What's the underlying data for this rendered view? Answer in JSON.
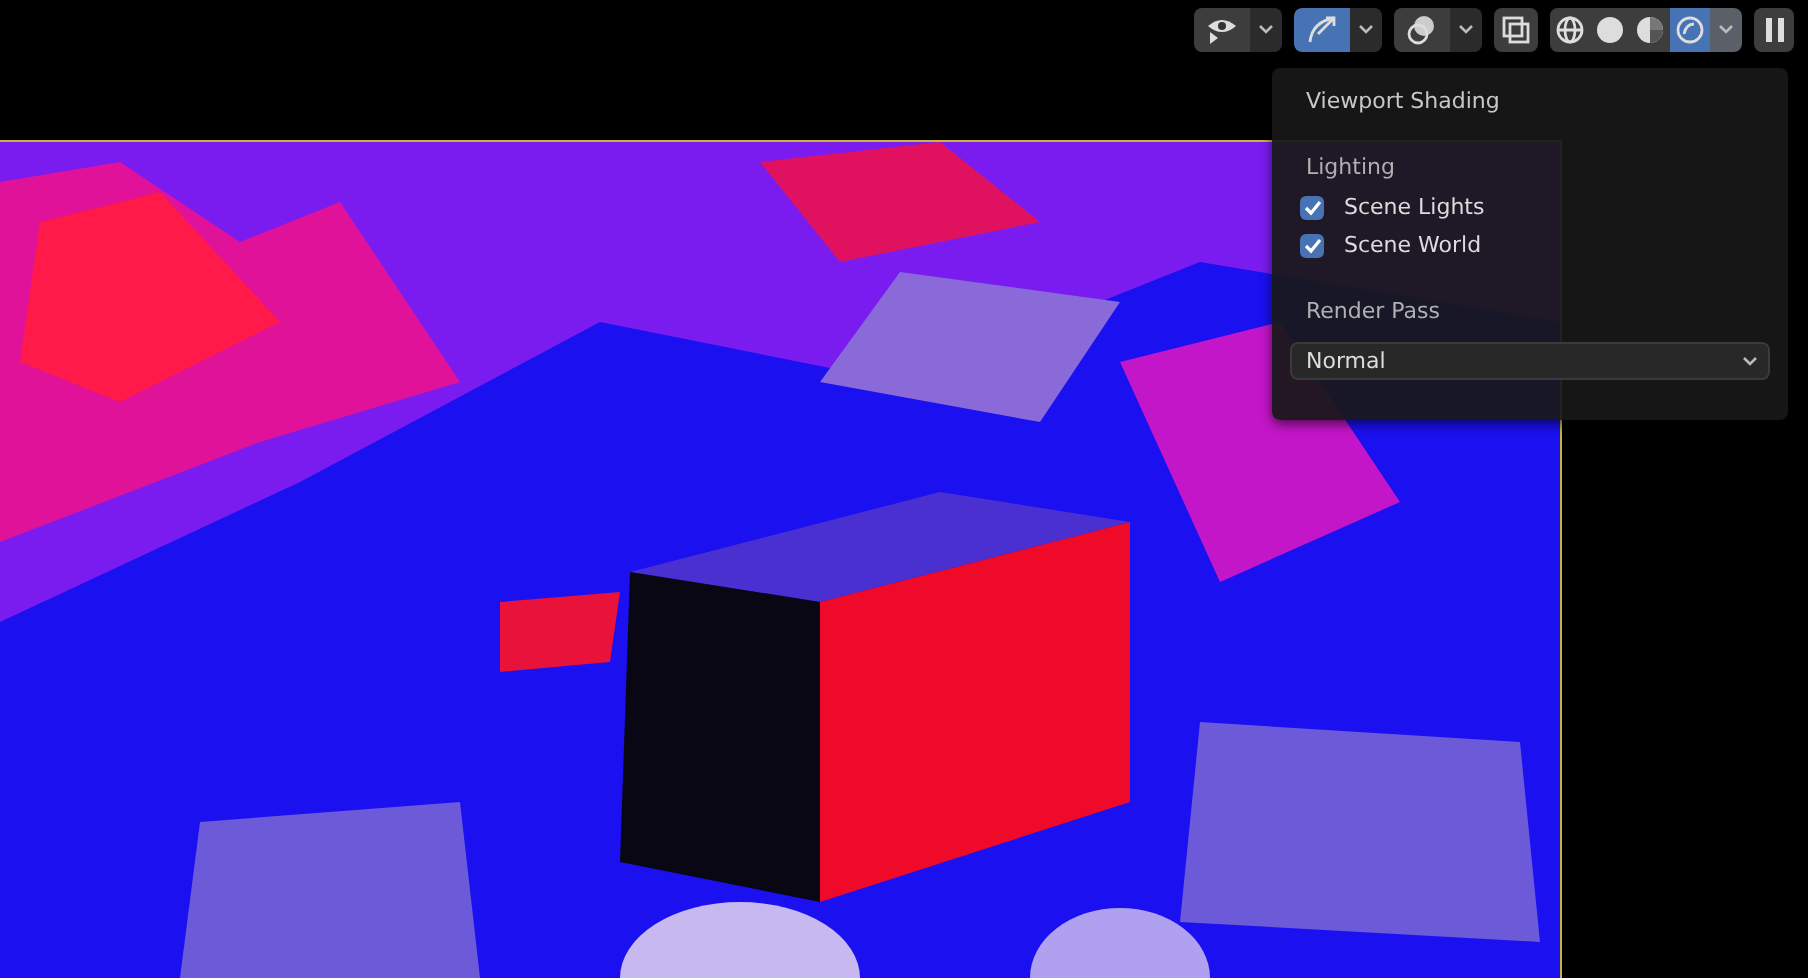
{
  "header": {
    "tools": [
      {
        "kind": "visibility",
        "selected": false
      },
      {
        "kind": "gizmo",
        "selected": true
      },
      {
        "kind": "overlay",
        "selected": false
      },
      {
        "kind": "xray",
        "selected": false
      }
    ],
    "shading_modes": [
      {
        "kind": "wireframe",
        "selected": false
      },
      {
        "kind": "solid",
        "selected": false
      },
      {
        "kind": "material",
        "selected": false
      },
      {
        "kind": "rendered",
        "selected": true
      }
    ]
  },
  "shading_popover": {
    "title": "Viewport Shading",
    "lighting": {
      "heading": "Lighting",
      "options": [
        {
          "label": "Scene Lights",
          "checked": true
        },
        {
          "label": "Scene World",
          "checked": true
        }
      ]
    },
    "render_pass": {
      "label": "Render Pass",
      "value": "Normal"
    }
  }
}
